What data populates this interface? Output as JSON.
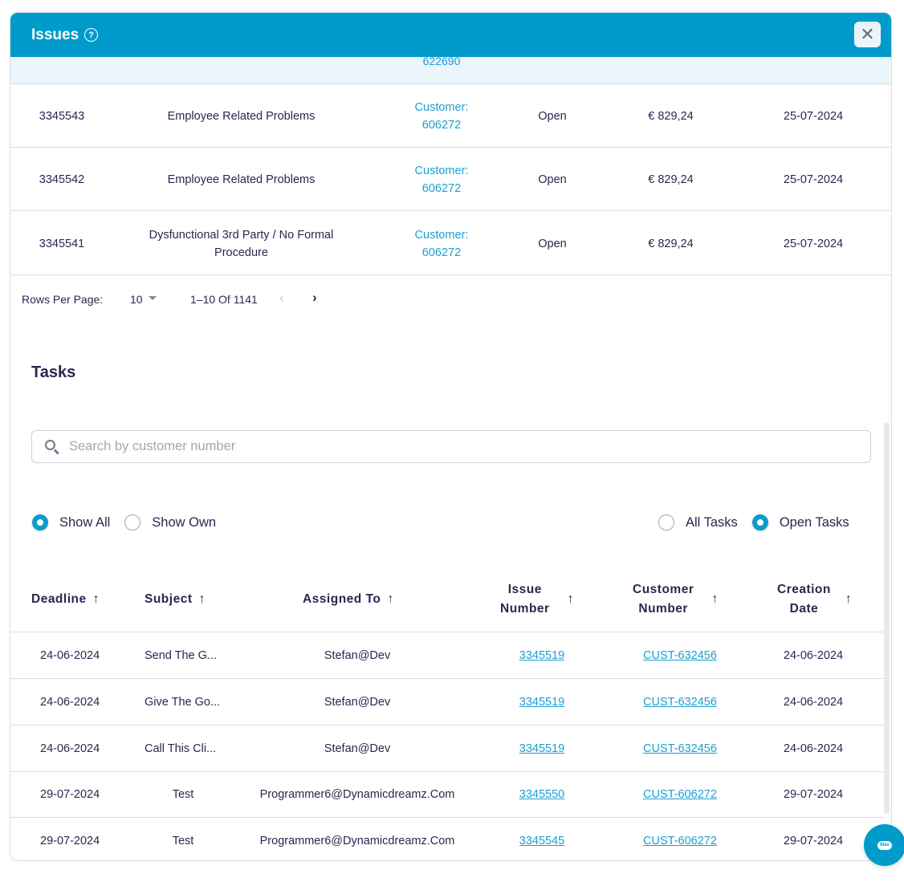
{
  "header": {
    "title": "Issues",
    "help_icon": "question-circle-icon",
    "close_icon": "close-icon",
    "accent": "#009bcb"
  },
  "issues": {
    "partial_row": {
      "customer": "622690"
    },
    "rows": [
      {
        "id": "3345543",
        "subject": "Employee Related Problems",
        "customer_label": "Customer:",
        "customer_number": "606272",
        "status": "Open",
        "amount": "€ 829,24",
        "date": "25-07-2024"
      },
      {
        "id": "3345542",
        "subject": "Employee Related Problems",
        "customer_label": "Customer:",
        "customer_number": "606272",
        "status": "Open",
        "amount": "€ 829,24",
        "date": "25-07-2024"
      },
      {
        "id": "3345541",
        "subject": "Dysfunctional 3rd Party / No Formal Procedure",
        "customer_label": "Customer:",
        "customer_number": "606272",
        "status": "Open",
        "amount": "€ 829,24",
        "date": "25-07-2024"
      }
    ],
    "pagination": {
      "rows_per_page_label": "Rows Per Page:",
      "rows_per_page": "10",
      "range": "1–10 Of 1141",
      "prev": "‹",
      "next": "›"
    }
  },
  "tasks": {
    "title": "Tasks",
    "search": {
      "placeholder": "Search by customer number",
      "value": ""
    },
    "filters_owner": [
      {
        "label": "Show All",
        "selected": true
      },
      {
        "label": "Show Own",
        "selected": false
      }
    ],
    "filters_state": [
      {
        "label": "All Tasks",
        "selected": false
      },
      {
        "label": "Open Tasks",
        "selected": true
      }
    ],
    "columns": [
      {
        "label": "Deadline",
        "sort": "↑"
      },
      {
        "label": "Subject",
        "sort": "↑"
      },
      {
        "label": "Assigned To",
        "sort": "↑"
      },
      {
        "label": "Issue Number",
        "line1": "Issue",
        "line2": "Number",
        "sort": "↑"
      },
      {
        "label": "Customer Number",
        "line1": "Customer",
        "line2": "Number",
        "sort": "↑"
      },
      {
        "label": "Creation Date",
        "line1": "Creation",
        "line2": "Date",
        "sort": "↑"
      }
    ],
    "rows": [
      {
        "deadline": "24-06-2024",
        "subject": "Send The G...",
        "assigned_to": "Stefan@Dev",
        "issue_number": "3345519",
        "customer_number": "CUST-632456",
        "creation_date": "24-06-2024"
      },
      {
        "deadline": "24-06-2024",
        "subject": "Give The Go...",
        "assigned_to": "Stefan@Dev",
        "issue_number": "3345519",
        "customer_number": "CUST-632456",
        "creation_date": "24-06-2024"
      },
      {
        "deadline": "24-06-2024",
        "subject": "Call This Cli...",
        "assigned_to": "Stefan@Dev",
        "issue_number": "3345519",
        "customer_number": "CUST-632456",
        "creation_date": "24-06-2024"
      },
      {
        "deadline": "29-07-2024",
        "subject": "Test",
        "assigned_to": "Programmer6@Dynamicdreamz.Com",
        "issue_number": "3345550",
        "customer_number": "CUST-606272",
        "creation_date": "29-07-2024"
      },
      {
        "deadline": "29-07-2024",
        "subject": "Test",
        "assigned_to": "Programmer6@Dynamicdreamz.Com",
        "issue_number": "3345545",
        "customer_number": "CUST-606272",
        "creation_date": "29-07-2024"
      }
    ]
  },
  "chat_widget": {
    "label": "Max",
    "icon": "cloud-chat-icon"
  }
}
